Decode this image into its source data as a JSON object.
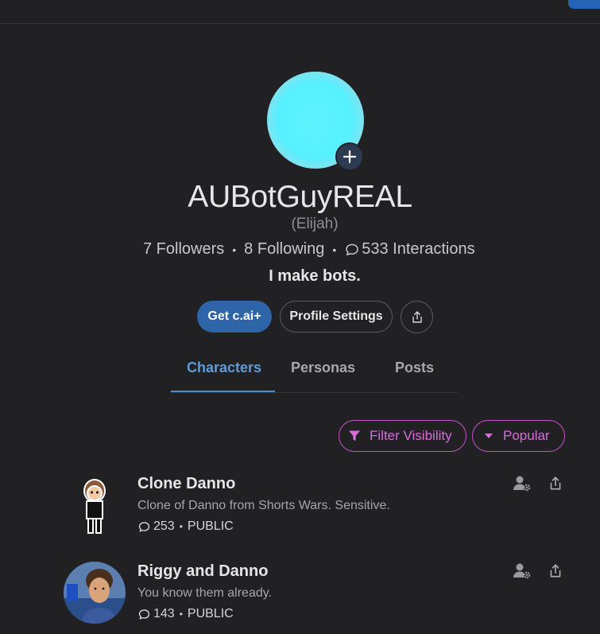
{
  "profile": {
    "username": "AUBotGuyREAL",
    "display_name": "(Elijah)",
    "followers": "7 Followers",
    "following": "8 Following",
    "interactions": "533 Interactions",
    "bio": "I make bots.",
    "avatar_color": "#56f0ff"
  },
  "actions": {
    "get_plus": "Get c.ai+",
    "profile_settings": "Profile Settings"
  },
  "tabs": [
    {
      "label": "Characters",
      "active": true
    },
    {
      "label": "Personas",
      "active": false
    },
    {
      "label": "Posts",
      "active": false
    }
  ],
  "filters": {
    "visibility": "Filter Visibility",
    "sort": "Popular"
  },
  "characters": [
    {
      "name": "Clone Danno",
      "description": "Clone of Danno from Shorts Wars. Sensitive.",
      "interactions": "253",
      "visibility": "PUBLIC"
    },
    {
      "name": "Riggy and Danno",
      "description": "You know them already.",
      "interactions": "143",
      "visibility": "PUBLIC"
    }
  ],
  "colors": {
    "background": "#212123",
    "accent_blue": "#2e65a8",
    "tab_active": "#5e9bd8",
    "filter_pink": "#d86ddc"
  },
  "icons": [
    "plus-icon",
    "chat-bubble-icon",
    "share-icon",
    "filter-icon",
    "caret-down-icon",
    "manage-user-icon"
  ]
}
